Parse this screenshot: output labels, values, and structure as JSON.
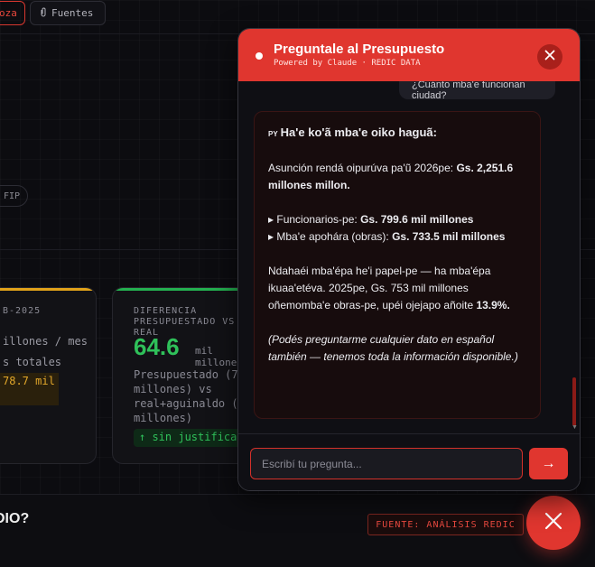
{
  "topbar": {
    "active_tab_label": "oza",
    "fuentes_label": "Fuentes",
    "fuentes_icon": "paperclip-icon"
  },
  "chip_label": "FIP",
  "card1": {
    "label": "B-2025",
    "line1": "illones / mes",
    "line2": "s totales",
    "warn_value": "78.7 mil"
  },
  "card2": {
    "label": "DIFERENCIA PRESUPUESTADO VS REAL",
    "value": "64.6",
    "unit": "mil millones",
    "desc": "Presupuestado (7... millones) vs real+aguinaldo (... millones)",
    "badge": "↑ sin justificar"
  },
  "section": {
    "title": "DIO?",
    "source_badge": "FUENTE: ANÁLISIS REDIC"
  },
  "chat": {
    "title": "Preguntale al Presupuesto",
    "subtitle": "Powered by Claude · REDIC DATA",
    "user_message": "¿Cuánto mba'e funcionan ciudad?",
    "bot": {
      "lang_tag": "PY",
      "heading": "Ha'e ko'ã mba'e oiko haguã:",
      "p1_text": "Asunción rendá oipurúva pa'ũ 2026pe: ",
      "p1_bold": "Gs. 2,251.6 millones millon.",
      "b1_label": "▸ Funcionarios-pe: ",
      "b1_value": "Gs. 799.6 mil millones",
      "b2_label": "▸ Mba'e apohára (obras): ",
      "b2_value": "Gs. 733.5 mil millones",
      "p3_text": "Ndahaéi mba'épa he'i papel-pe — ha mba'épa ikuaa'etéva. 2025pe, Gs. 753 mil millones oñemomba'e obras-pe, upéi ojejapo añoite ",
      "p3_bold": "13.9%.",
      "p4_italic": "(Podés preguntarme cualquier dato en español también — tenemos toda la información disponible.)"
    },
    "input_placeholder": "Escribí tu pregunta...",
    "send_label": "→"
  },
  "colors": {
    "accent": "#e0362f",
    "green": "#2fc15a",
    "amber": "#e0a21a"
  }
}
